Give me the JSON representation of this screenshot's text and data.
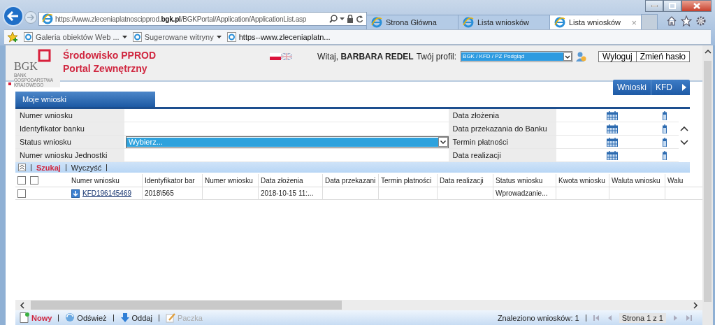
{
  "browser": {
    "address": {
      "url": "https://www.zleceniaplatnoscipprod.**bgk.pl**/BGKPortal/Application/ApplicationList.asp"
    },
    "tabs": [
      {
        "title": "Strona Główna",
        "selected": false
      },
      {
        "title": "Lista wniosków",
        "selected": false
      },
      {
        "title": "Lista wniosków",
        "selected": true,
        "close": "×"
      }
    ],
    "favorites": [
      {
        "label": "Galeria obiektów Web ...",
        "kind": "dropdown"
      },
      {
        "label": "Sugerowane witryny",
        "kind": "dropdown"
      },
      {
        "label": "https--www.zleceniaplatn...",
        "kind": "link"
      }
    ]
  },
  "header": {
    "logo": {
      "mark": "BGK",
      "caption": "BANK GOSPODARSTWA KRAJOWEGO"
    },
    "title_lines": [
      "Środowisko PPROD",
      "Portal Zewnętrzny"
    ],
    "languages": [
      {
        "kind": "polish",
        "selected": true
      },
      {
        "kind": "english",
        "selected": false
      }
    ],
    "greeting": "Witaj,",
    "user": "BARBARA REDEL",
    "profile_label": "Twój profil:",
    "profile": "BGK / KFD / PZ Podgląd",
    "buttons": [
      "Wyloguj",
      "Zmień hasło"
    ],
    "menu": [
      "Wnioski",
      "KFD"
    ]
  },
  "panel": {
    "tab": "Moje wnioski",
    "filters": [
      {
        "label": "Numer wniosku",
        "kind": "text"
      },
      {
        "label": "Identyfikator banku",
        "kind": "text"
      },
      {
        "label": "Status wniosku",
        "kind": "select",
        "value": "Wybierz..."
      },
      {
        "label": "Numer wniosku Jednostki",
        "kind": "text"
      }
    ],
    "date_filters": [
      "Data złożenia",
      "Data przekazania do Banku",
      "Termin płatności",
      "Data realizacji"
    ],
    "actions": [
      {
        "label": "Szukaj",
        "emphasis": true
      },
      {
        "label": "Wyczyść",
        "emphasis": false
      }
    ]
  },
  "table": {
    "header_checkboxes": [
      {
        "checked": false
      },
      {
        "checked": false
      }
    ],
    "columns": [
      "Numer wniosku",
      "Identyfikator bar",
      "Numer wniosku",
      "Data złożenia",
      "Data przekazani",
      "Termin płatności",
      "Data realizacji",
      "Status wniosku",
      "Kwota wniosku",
      "Waluta wniosku",
      "Walu"
    ],
    "rows": [
      {
        "checked": false,
        "cells": [
          "KFD196145469",
          "2018\\565",
          "",
          "2018-10-15 11:...",
          "",
          "",
          "",
          "Wprowadzanie...",
          "",
          "",
          ""
        ]
      }
    ]
  },
  "toolbar": {
    "buttons": [
      {
        "label": "Nowy",
        "kind": "new",
        "disabled": false
      },
      {
        "label": "Odśwież",
        "kind": "refresh",
        "disabled": false
      },
      {
        "label": "Oddaj",
        "kind": "submit",
        "disabled": false
      },
      {
        "label": "Paczka",
        "kind": "package",
        "disabled": true
      }
    ],
    "count": "Znaleziono wniosków: 1",
    "page": "Strona 1 z 1"
  }
}
